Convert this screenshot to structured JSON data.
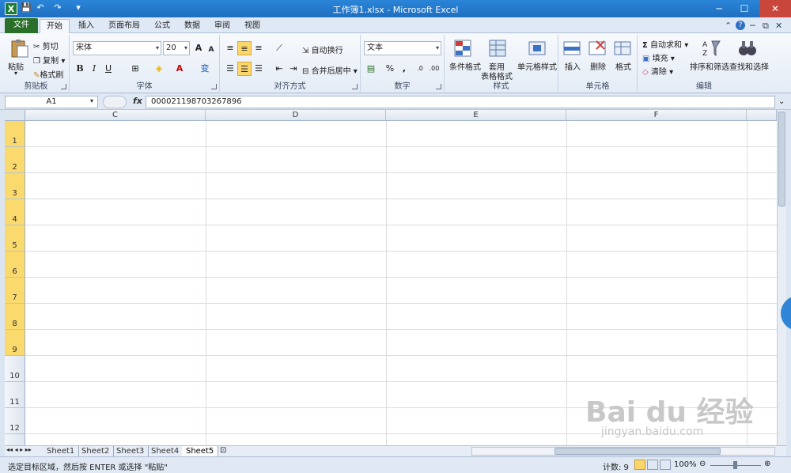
{
  "window": {
    "title": "工作簿1.xlsx - Microsoft Excel",
    "min": "─",
    "max": "☐",
    "close": "✕"
  },
  "quick_access": {
    "save": "💾",
    "undo": "↶",
    "redo": "↷",
    "customize": "▾"
  },
  "tabs": [
    {
      "label": "文件"
    },
    {
      "label": "开始"
    },
    {
      "label": "插入"
    },
    {
      "label": "页面布局"
    },
    {
      "label": "公式"
    },
    {
      "label": "数据"
    },
    {
      "label": "审阅"
    },
    {
      "label": "视图"
    }
  ],
  "ribbon_right": {
    "collapse": "⌃",
    "help": "?",
    "min": "─",
    "restore": "⧉",
    "close": "✕"
  },
  "clipboard": {
    "paste": "粘贴",
    "cut": "剪切",
    "copy": "复制",
    "format_painter": "格式刷",
    "label": "剪贴板"
  },
  "font": {
    "name": "宋体",
    "size": "20",
    "bold": "B",
    "italic": "I",
    "underline": "U",
    "grow": "A",
    "shrink": "A",
    "phonetic": "变",
    "label": "字体"
  },
  "align": {
    "wrap": "自动换行",
    "merge": "合并后居中",
    "label": "对齐方式"
  },
  "number": {
    "format": "文本",
    "percent": "%",
    "comma": ",",
    "inc": ".0",
    "dec": ".00",
    "label": "数字"
  },
  "styles": {
    "cond": "条件格式",
    "table1": "套用",
    "table2": "表格格式",
    "cell": "单元格样式",
    "label": "样式"
  },
  "cells": {
    "insert": "插入",
    "delete": "删除",
    "format": "格式",
    "label": "单元格"
  },
  "editing": {
    "autosum": "自动求和",
    "fill": "填充",
    "clear": "清除",
    "sort": "排序和筛选",
    "find": "查找和选择",
    "label": "编辑"
  },
  "formula_bar": {
    "name_box": "A1",
    "fx": "fx",
    "content": "000021198703267896"
  },
  "columns": [
    {
      "label": "C"
    },
    {
      "label": "D"
    },
    {
      "label": "E"
    },
    {
      "label": "F"
    }
  ],
  "rows": [
    {
      "label": "1"
    },
    {
      "label": "2"
    },
    {
      "label": "3"
    },
    {
      "label": "4"
    },
    {
      "label": "5"
    },
    {
      "label": "6"
    },
    {
      "label": "7"
    },
    {
      "label": "8"
    },
    {
      "label": "9"
    },
    {
      "label": "10"
    },
    {
      "label": "11"
    },
    {
      "label": "12"
    }
  ],
  "sheets": [
    {
      "label": "Sheet1"
    },
    {
      "label": "Sheet2"
    },
    {
      "label": "Sheet3"
    },
    {
      "label": "Sheet4"
    },
    {
      "label": "Sheet5"
    }
  ],
  "status": {
    "message": "选定目标区域，然后按 ENTER 或选择 \"粘贴\"",
    "count": "计数: 9",
    "zoom": "100%"
  },
  "watermark": {
    "brand": "Bai du 经验",
    "url": "jingyan.baidu.com"
  },
  "colors": {
    "title": "#1f6fc0",
    "file_tab": "#2a6f2a",
    "selected_row": "#fad96d"
  }
}
